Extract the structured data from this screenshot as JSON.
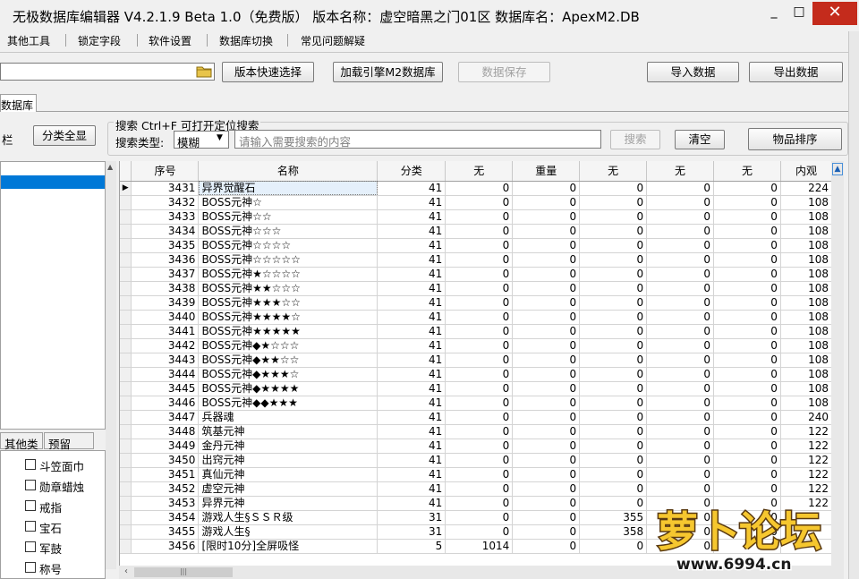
{
  "window": {
    "title": "无极数据库编辑器 V4.2.1.9   Beta 1.0（免费版）   版本名称：虚空暗黑之门01区   数据库名：ApexM2.DB",
    "min": "_",
    "max": "□",
    "close": "✕"
  },
  "menu": [
    "其他工具",
    "锁定字段",
    "软件设置",
    "数据库切换",
    "常见问题解疑"
  ],
  "toolbar": {
    "version_select": "版本快速选择",
    "load_db": "加载引擎M2数据库",
    "save_data": "数据保存",
    "import_data": "导入数据",
    "export_data": "导出数据"
  },
  "tab": "数据库",
  "left": {
    "label": "栏",
    "all_categories": "分类全显",
    "tabs": [
      "其他类",
      "预留"
    ],
    "checks": [
      "斗笠面巾",
      "勋章蜡烛",
      "戒指",
      "宝石",
      "军鼓",
      "称号"
    ]
  },
  "search": {
    "title": "搜索  Ctrl+F 可打开定位搜索",
    "type_label": "搜索类型:",
    "type_value": "模糊",
    "placeholder": "请输入需要搜索的内容",
    "search_btn": "搜索",
    "clear_btn": "清空",
    "sort_btn": "物品排序"
  },
  "grid": {
    "columns": [
      "序号",
      "名称",
      "分类",
      "无",
      "重量",
      "无",
      "无",
      "无",
      "内观"
    ],
    "rows": [
      [
        "3431",
        "异界觉醒石",
        "41",
        "0",
        "0",
        "0",
        "0",
        "0",
        "224"
      ],
      [
        "3432",
        "BOSS元神☆",
        "41",
        "0",
        "0",
        "0",
        "0",
        "0",
        "108"
      ],
      [
        "3433",
        "BOSS元神☆☆",
        "41",
        "0",
        "0",
        "0",
        "0",
        "0",
        "108"
      ],
      [
        "3434",
        "BOSS元神☆☆☆",
        "41",
        "0",
        "0",
        "0",
        "0",
        "0",
        "108"
      ],
      [
        "3435",
        "BOSS元神☆☆☆☆",
        "41",
        "0",
        "0",
        "0",
        "0",
        "0",
        "108"
      ],
      [
        "3436",
        "BOSS元神☆☆☆☆☆",
        "41",
        "0",
        "0",
        "0",
        "0",
        "0",
        "108"
      ],
      [
        "3437",
        "BOSS元神★☆☆☆☆",
        "41",
        "0",
        "0",
        "0",
        "0",
        "0",
        "108"
      ],
      [
        "3438",
        "BOSS元神★★☆☆☆",
        "41",
        "0",
        "0",
        "0",
        "0",
        "0",
        "108"
      ],
      [
        "3439",
        "BOSS元神★★★☆☆",
        "41",
        "0",
        "0",
        "0",
        "0",
        "0",
        "108"
      ],
      [
        "3440",
        "BOSS元神★★★★☆",
        "41",
        "0",
        "0",
        "0",
        "0",
        "0",
        "108"
      ],
      [
        "3441",
        "BOSS元神★★★★★",
        "41",
        "0",
        "0",
        "0",
        "0",
        "0",
        "108"
      ],
      [
        "3442",
        "BOSS元神◆★☆☆☆",
        "41",
        "0",
        "0",
        "0",
        "0",
        "0",
        "108"
      ],
      [
        "3443",
        "BOSS元神◆★★☆☆",
        "41",
        "0",
        "0",
        "0",
        "0",
        "0",
        "108"
      ],
      [
        "3444",
        "BOSS元神◆★★★☆",
        "41",
        "0",
        "0",
        "0",
        "0",
        "0",
        "108"
      ],
      [
        "3445",
        "BOSS元神◆★★★★",
        "41",
        "0",
        "0",
        "0",
        "0",
        "0",
        "108"
      ],
      [
        "3446",
        "BOSS元神◆◆★★★",
        "41",
        "0",
        "0",
        "0",
        "0",
        "0",
        "108"
      ],
      [
        "3447",
        "兵器魂",
        "41",
        "0",
        "0",
        "0",
        "0",
        "0",
        "240"
      ],
      [
        "3448",
        "筑基元神",
        "41",
        "0",
        "0",
        "0",
        "0",
        "0",
        "122"
      ],
      [
        "3449",
        "金丹元神",
        "41",
        "0",
        "0",
        "0",
        "0",
        "0",
        "122"
      ],
      [
        "3450",
        "出窍元神",
        "41",
        "0",
        "0",
        "0",
        "0",
        "0",
        "122"
      ],
      [
        "3451",
        "真仙元神",
        "41",
        "0",
        "0",
        "0",
        "0",
        "0",
        "122"
      ],
      [
        "3452",
        "虚空元神",
        "41",
        "0",
        "0",
        "0",
        "0",
        "0",
        "122"
      ],
      [
        "3453",
        "异界元神",
        "41",
        "0",
        "0",
        "0",
        "0",
        "0",
        "122"
      ],
      [
        "3454",
        "游戏人生§ＳＳＲ级",
        "31",
        "0",
        "0",
        "355",
        "0",
        "0",
        ""
      ],
      [
        "3455",
        "游戏人生§",
        "31",
        "0",
        "0",
        "358",
        "0",
        "0",
        ""
      ],
      [
        "3456",
        "[限时10分]全屏吸怪",
        "5",
        "1014",
        "0",
        "0",
        "0",
        "0",
        ""
      ]
    ]
  },
  "watermark": {
    "brand": "萝卜论坛",
    "url": "www.6994.cn"
  }
}
